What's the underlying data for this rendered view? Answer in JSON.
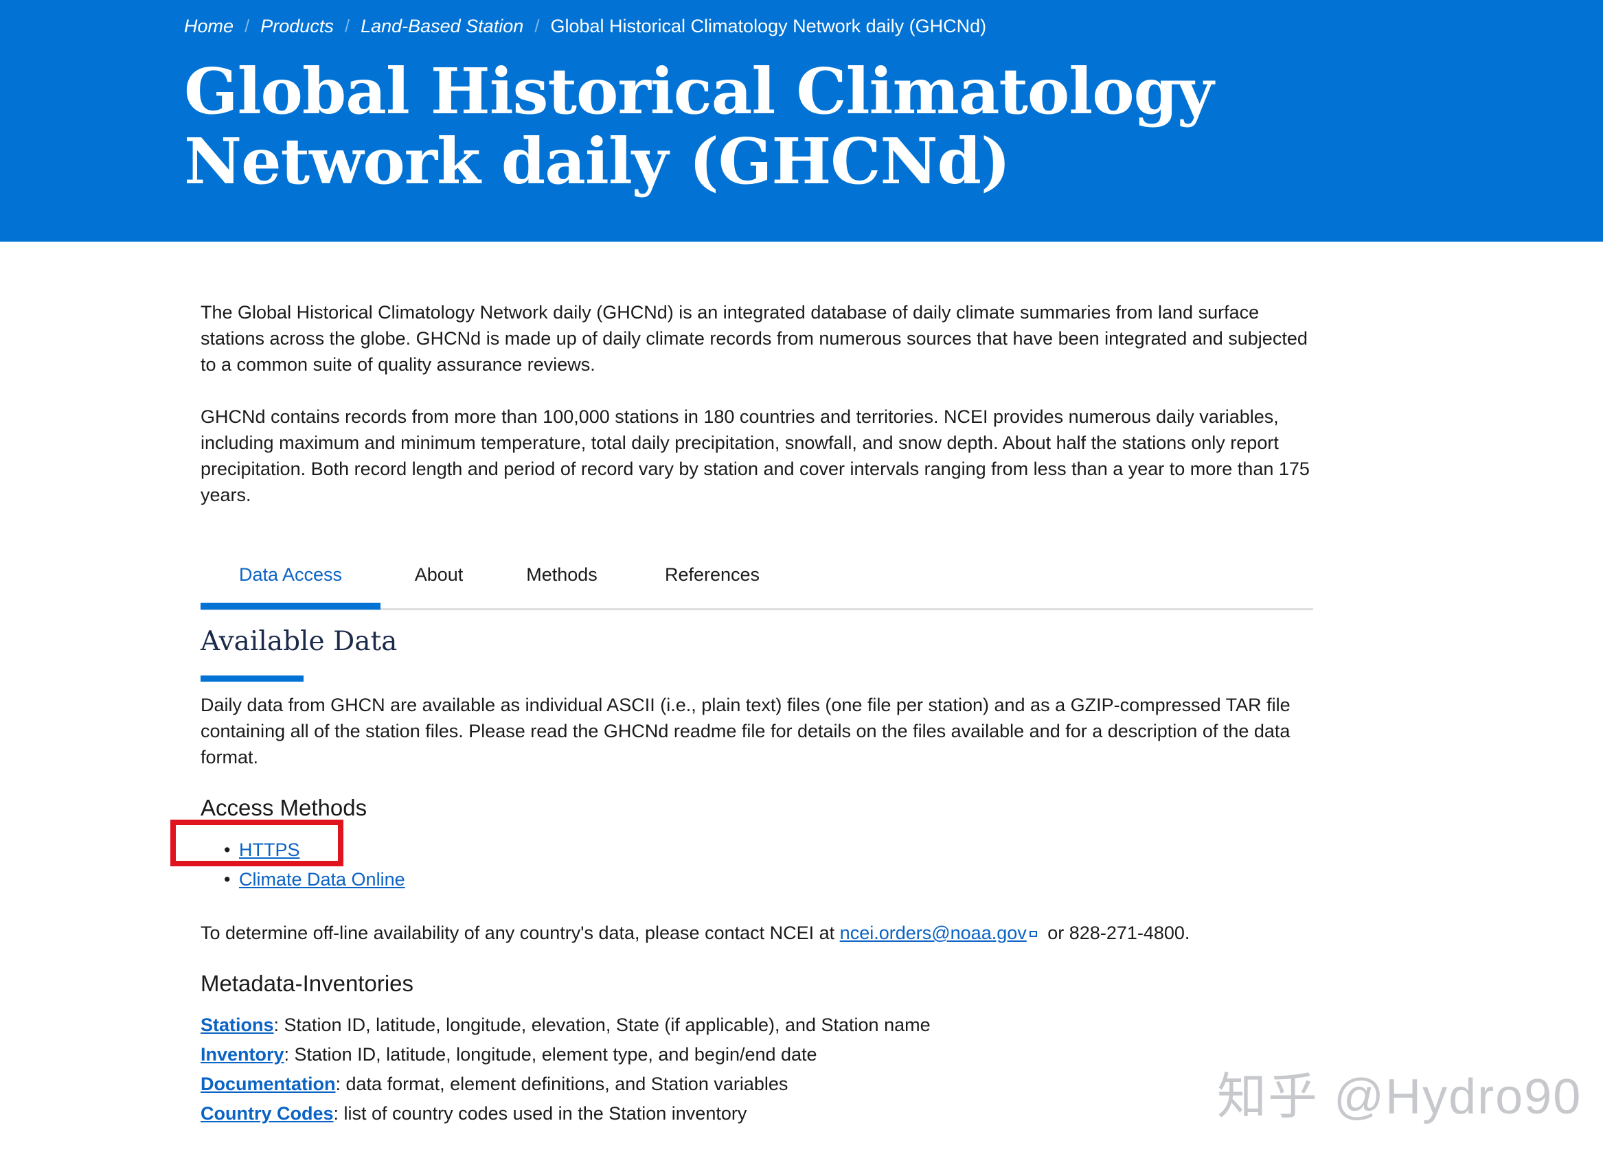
{
  "breadcrumb": {
    "items": [
      "Home",
      "Products",
      "Land-Based Station"
    ],
    "current": "Global Historical Climatology Network daily (GHCNd)"
  },
  "header": {
    "title": "Global Historical Climatology Network daily (GHCNd)"
  },
  "intro": {
    "p1": "The Global Historical Climatology Network daily (GHCNd) is an integrated database of daily climate summaries from land surface stations across the globe. GHCNd is made up of daily climate records from numerous sources that have been integrated and subjected to a common suite of quality assurance reviews.",
    "p2": "GHCNd contains records from more than 100,000 stations in 180 countries and territories. NCEI provides numerous daily variables, including maximum and minimum temperature, total daily precipitation, snowfall, and snow depth. About half the stations only report precipitation. Both record length and period of record vary by station and cover intervals ranging from less than a year to more than 175 years."
  },
  "tabs": [
    {
      "label": "Data Access",
      "active": true
    },
    {
      "label": "About",
      "active": false
    },
    {
      "label": "Methods",
      "active": false
    },
    {
      "label": "References",
      "active": false
    }
  ],
  "available_data": {
    "title": "Available Data",
    "text": "Daily data from GHCN are available as individual ASCII (i.e., plain text) files (one file per station) and as a GZIP-compressed TAR file containing all of the station files. Please read the GHCNd readme file for details on the files available and for a description of the data format."
  },
  "access_methods": {
    "title": "Access Methods",
    "links": [
      "HTTPS",
      "Climate Data Online"
    ]
  },
  "contact": {
    "prefix": "To determine off-line availability of any country's data, please contact NCEI at",
    "email": "ncei.orders@noaa.gov",
    "suffix": "or 828-271-4800."
  },
  "metadata": {
    "title": "Metadata-Inventories",
    "items": [
      {
        "link": "Stations",
        "desc": ": Station ID, latitude, longitude, elevation, State (if applicable), and Station name"
      },
      {
        "link": "Inventory",
        "desc": ": Station ID, latitude, longitude, element type, and begin/end date"
      },
      {
        "link": "Documentation",
        "desc": ": data format, element definitions, and Station variables"
      },
      {
        "link": "Country Codes",
        "desc": ": list of country codes used in the Station inventory"
      }
    ]
  },
  "watermark": "知乎 @Hydro90",
  "colors": {
    "header_bg": "#0273d4",
    "link": "#0b63c4",
    "highlight": "#e0141e"
  }
}
